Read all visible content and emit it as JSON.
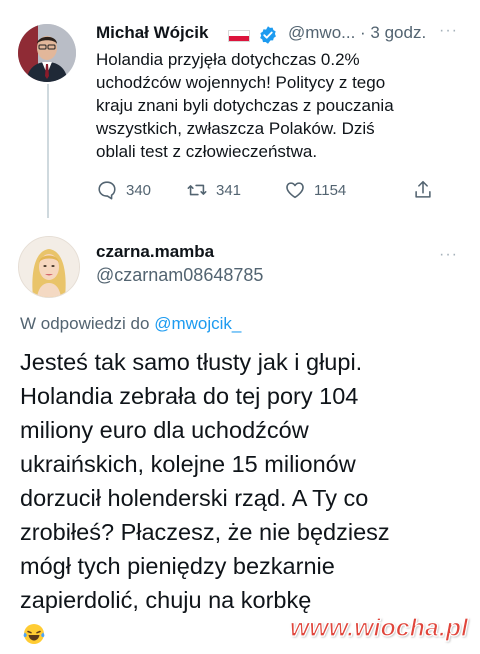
{
  "original_tweet": {
    "author_name": "Michał Wójcik",
    "meta": "@mwo... · 3 godz.",
    "more": "···",
    "text_lines": [
      "Holandia przyjęła dotychczas 0.2%",
      "uchodźców wojennych! Politycy z tego",
      "kraju znani byli dotychczas z pouczania",
      "wszystkich, zwłaszcza Polaków. Dziś",
      "oblali test z człowieczeństwa."
    ],
    "stats": {
      "replies": "340",
      "retweets": "341",
      "likes": "1154"
    }
  },
  "reply_tweet": {
    "author_name": "czarna.mamba",
    "handle": "@czarnam08648785",
    "more": "···",
    "reply_prefix": "W odpowiedzi do ",
    "reply_mention": "@mwojcik_",
    "text_lines": [
      "Jesteś tak samo tłusty jak i głupi.",
      "Holandia zebrała do tej pory 104",
      "miliony euro dla uchodźców",
      "ukraińskich, kolejne 15 milionów",
      "dorzucił holenderski rząd. A Ty co",
      "zrobiłeś? Płaczesz, że nie będziesz",
      "mógł tych pieniędzy bezkarnie",
      "zapierdolić, chuju na korbkę"
    ],
    "emoji": "laughing-tears-emoji"
  },
  "watermark": "www.wiocha.pl",
  "colors": {
    "link": "#1d9bf0",
    "muted": "#536471",
    "verified": "#1d9bf0",
    "watermark": "#e0453b"
  }
}
